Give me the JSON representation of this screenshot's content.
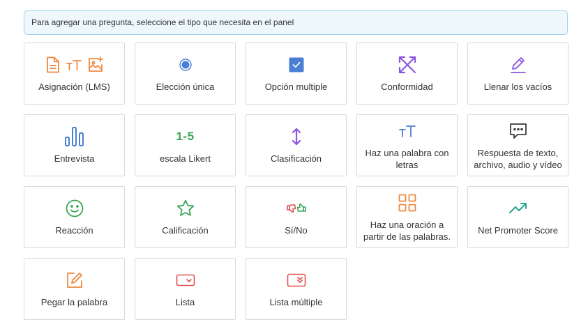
{
  "notice": "Para agregar una pregunta, seleccione el tipo que necesita en el panel",
  "tiles": [
    {
      "label": "Asignación (LMS)"
    },
    {
      "label": "Elección única"
    },
    {
      "label": "Opción multiple"
    },
    {
      "label": "Conformidad"
    },
    {
      "label": "Llenar los vacíos"
    },
    {
      "label": "Entrevista"
    },
    {
      "label": "escala Likert",
      "icon_text": "1-5"
    },
    {
      "label": "Clasificación"
    },
    {
      "label": "Haz una palabra con letras"
    },
    {
      "label": "Respuesta de texto, archivo, audio y vídeo"
    },
    {
      "label": "Reacción"
    },
    {
      "label": "Calificación"
    },
    {
      "label": "Sí/No"
    },
    {
      "label": "Haz una oración a partir de las palabras."
    },
    {
      "label": "Net Promoter Score"
    },
    {
      "label": "Pegar la palabra"
    },
    {
      "label": "Lista"
    },
    {
      "label": "Lista múltiple"
    }
  ],
  "colors": {
    "orange": "#f0883e",
    "blue": "#4a7fd4",
    "purple": "#8a55e0",
    "green": "#3aa655",
    "teal": "#27a58f",
    "red": "#e05050",
    "dark": "#3a3a3a"
  }
}
